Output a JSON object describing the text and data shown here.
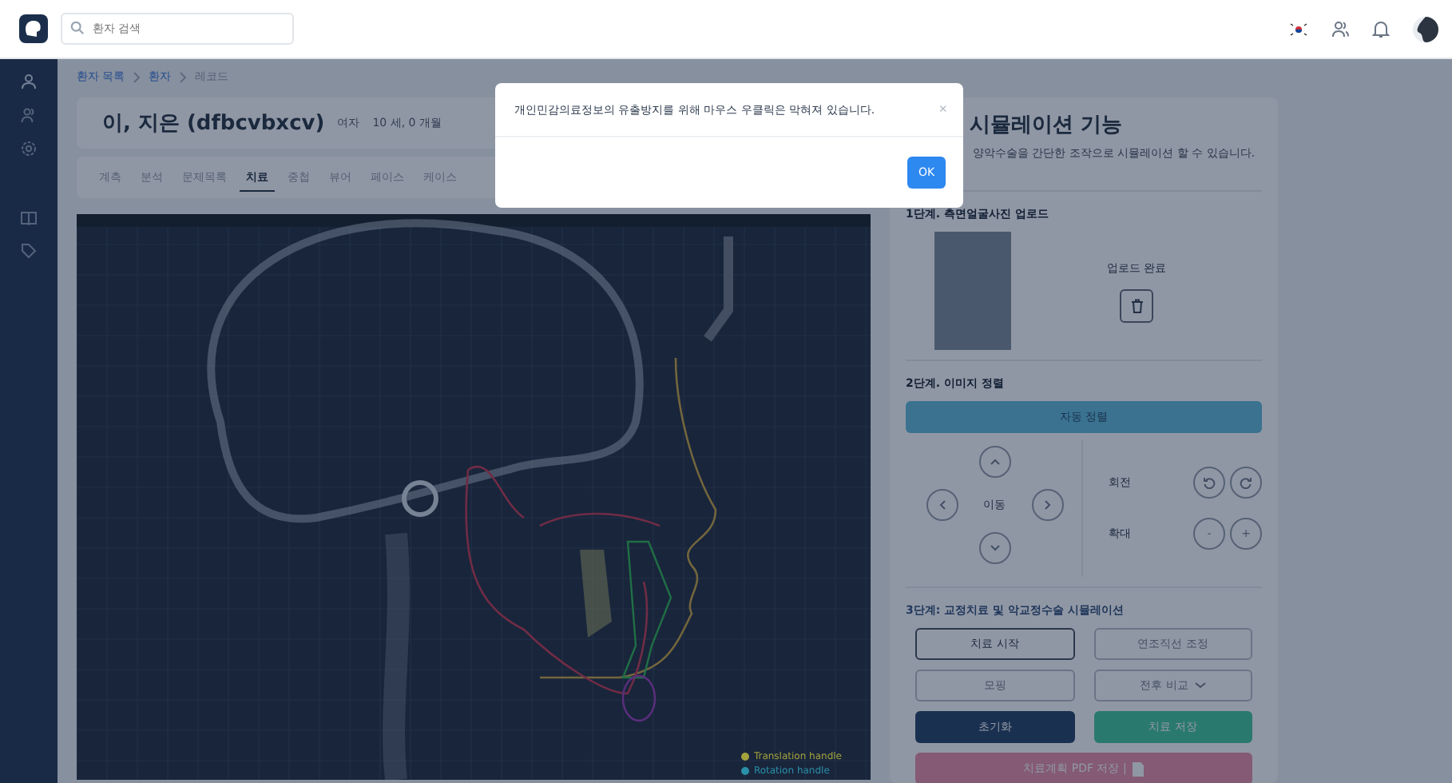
{
  "topbar": {
    "search": {
      "placeholder": "환자 검색"
    }
  },
  "breadcrumb": [
    {
      "label": "환자 목록",
      "link": true
    },
    {
      "label": "환자",
      "link": true
    },
    {
      "label": "레코드",
      "link": false
    }
  ],
  "patient": {
    "name": "이, 지은 (dfbcvbxcv)",
    "sex": "여자",
    "age": "10 세, 0 개월"
  },
  "tabs": [
    {
      "label": "계측",
      "selected": false
    },
    {
      "label": "분석",
      "selected": false
    },
    {
      "label": "문제목록",
      "selected": false
    },
    {
      "label": "치료",
      "selected": true
    },
    {
      "label": "중첩",
      "selected": false
    },
    {
      "label": "뷰어",
      "selected": false
    },
    {
      "label": "페이스",
      "selected": false
    },
    {
      "label": "케이스",
      "selected": false
    }
  ],
  "xray": {
    "legend": [
      {
        "label": "Translation handle",
        "color": "#a3a23c"
      },
      {
        "label": "Rotation handle",
        "color": "#2a8fa8"
      }
    ]
  },
  "panel": {
    "title": "시뮬레이션 기능",
    "subtitle": "양악수술을 간단한 조작으로 시뮬레이션 할 수 있습니다.",
    "step1": {
      "title": "1단계. 측면얼굴사진 업로드",
      "status": "업로드 완료"
    },
    "step2": {
      "title": "2단계. 이미지 정렬",
      "auto_button": "자동 정렬",
      "move_label": "이동",
      "rotate_label": "회전",
      "zoom_label": "확대",
      "zoom_out": "-",
      "zoom_in": "+"
    },
    "step3": {
      "title": "3단계: 교정치료 및 악교정수술 시뮬레이션",
      "buttons": [
        {
          "label": "치료 시작",
          "kind": "outline",
          "disabled": false,
          "dropdown": false
        },
        {
          "label": "연조직선 조정",
          "kind": "outline",
          "disabled": true,
          "dropdown": false
        },
        {
          "label": "모핑",
          "kind": "outline",
          "disabled": true,
          "dropdown": false
        },
        {
          "label": "전후 비교",
          "kind": "outline",
          "disabled": true,
          "dropdown": true
        },
        {
          "label": "초기화",
          "kind": "dark",
          "disabled": false,
          "dropdown": false
        },
        {
          "label": "치료 저장",
          "kind": "success",
          "disabled": false,
          "dropdown": false
        },
        {
          "label": "치료계획 PDF 저장 |",
          "kind": "pdf",
          "disabled": false,
          "dropdown": false
        }
      ]
    }
  },
  "modal": {
    "message": "개인민감의료정보의 유출방지를 위해 마우스 우클릭은 막혀져 있습니다.",
    "close": "×",
    "ok": "OK"
  }
}
